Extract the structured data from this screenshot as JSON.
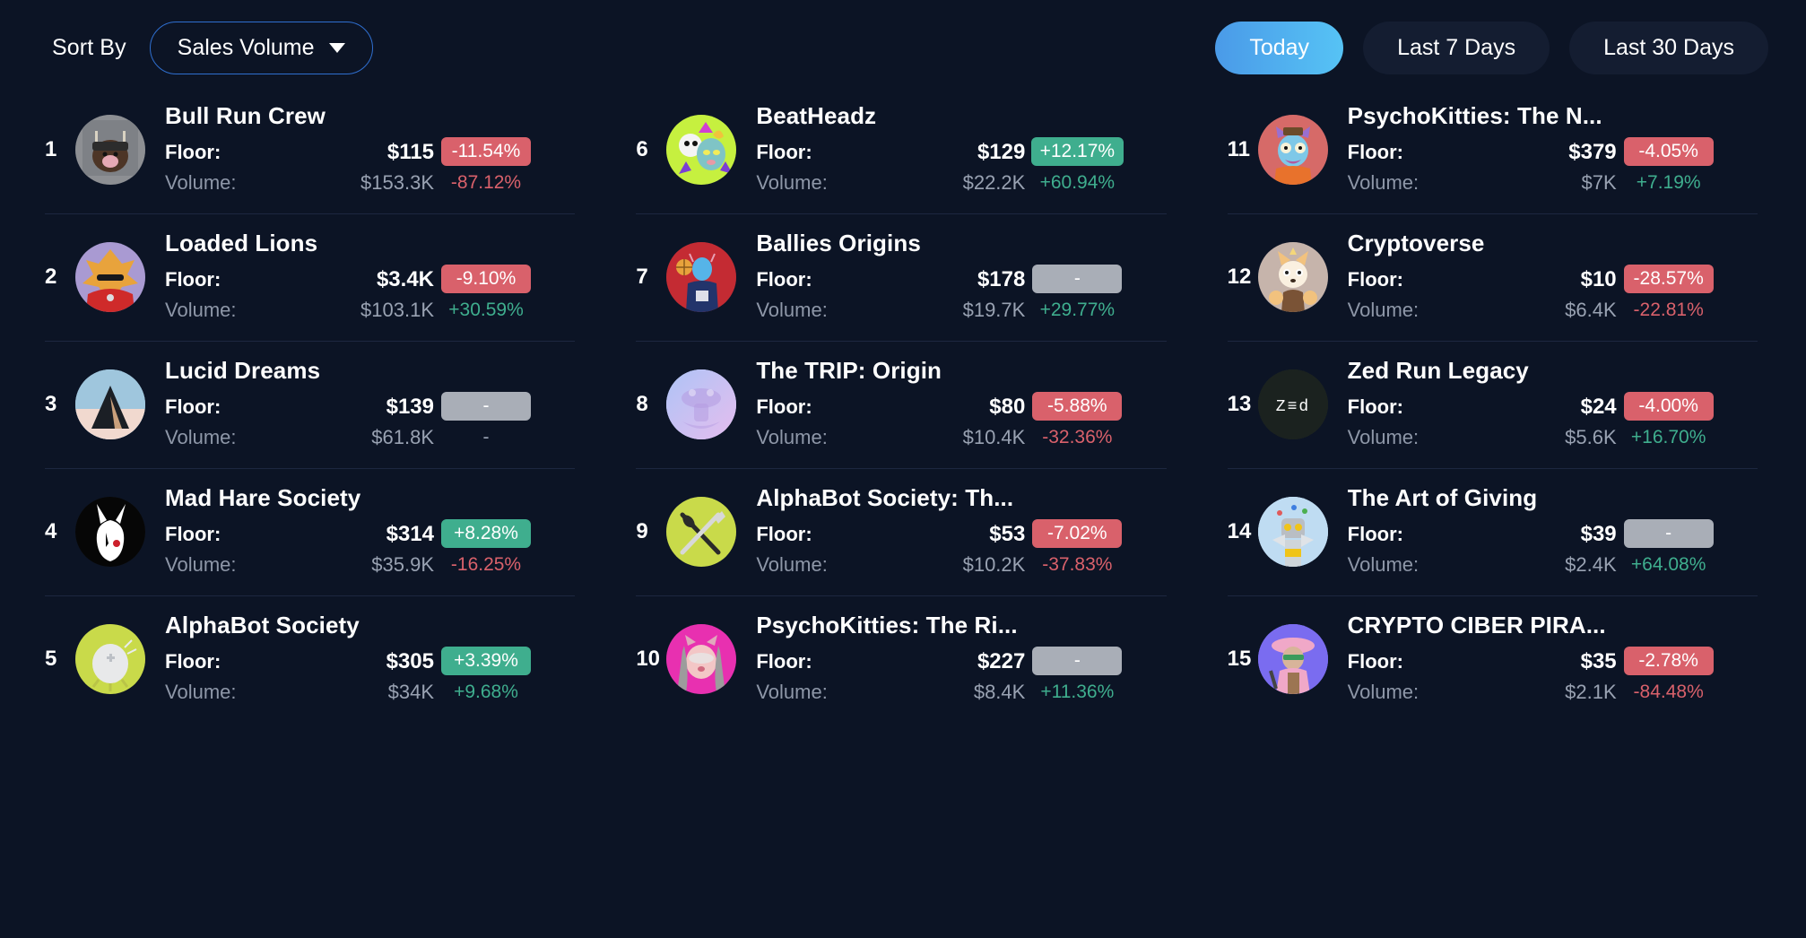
{
  "toolbar": {
    "sort_label": "Sort By",
    "sort_value": "Sales Volume",
    "ranges": [
      {
        "label": "Today",
        "active": true
      },
      {
        "label": "Last 7 Days",
        "active": false
      },
      {
        "label": "Last 30 Days",
        "active": false
      }
    ]
  },
  "labels": {
    "floor": "Floor:",
    "volume": "Volume:"
  },
  "colors": {
    "background": "#0c1425",
    "accent_gradient_from": "#4a9ae8",
    "accent_gradient_to": "#56c3f5",
    "badge_up": "#3fae8e",
    "badge_down": "#d9616b",
    "badge_flat": "#a9aeb7",
    "divider": "#1d2740",
    "muted_text": "#8e97a8"
  },
  "columns": [
    {
      "rows": [
        {
          "rank": "1",
          "name": "Bull Run Crew",
          "floor": "$115",
          "volume": "$153.3K",
          "floor_delta": "-11.54%",
          "floor_delta_dir": "down",
          "volume_delta": "-87.12%",
          "volume_delta_dir": "down",
          "avatar": {
            "bg": "#8d8f93",
            "fg": "#4d3526",
            "accent": "#2c2c2c",
            "kind": "bull"
          }
        },
        {
          "rank": "2",
          "name": "Loaded Lions",
          "floor": "$3.4K",
          "volume": "$103.1K",
          "floor_delta": "-9.10%",
          "floor_delta_dir": "down",
          "volume_delta": "+30.59%",
          "volume_delta_dir": "up",
          "avatar": {
            "bg": "#a99ad2",
            "fg": "#e8a33c",
            "accent": "#cf2a2a",
            "kind": "lion"
          }
        },
        {
          "rank": "3",
          "name": "Lucid Dreams",
          "floor": "$139",
          "volume": "$61.8K",
          "floor_delta": "-",
          "floor_delta_dir": "flat",
          "volume_delta": "-",
          "volume_delta_dir": "flat",
          "avatar": {
            "bg": "#9fc6dd",
            "fg": "#1b1f25",
            "accent": "#f1d9cf",
            "kind": "triangle"
          }
        },
        {
          "rank": "4",
          "name": "Mad Hare Society",
          "floor": "$314",
          "volume": "$35.9K",
          "floor_delta": "+8.28%",
          "floor_delta_dir": "up",
          "volume_delta": "-16.25%",
          "volume_delta_dir": "down",
          "avatar": {
            "bg": "#060606",
            "fg": "#ffffff",
            "accent": "#cc1f2b",
            "kind": "hare"
          }
        },
        {
          "rank": "5",
          "name": "AlphaBot Society",
          "floor": "$305",
          "volume": "$34K",
          "floor_delta": "+3.39%",
          "floor_delta_dir": "up",
          "volume_delta": "+9.68%",
          "volume_delta_dir": "up",
          "avatar": {
            "bg": "#c9da4a",
            "fg": "#e8e9ea",
            "accent": "#ffffff",
            "kind": "egg"
          }
        }
      ]
    },
    {
      "rows": [
        {
          "rank": "6",
          "name": "BeatHeadz",
          "floor": "$129",
          "volume": "$22.2K",
          "floor_delta": "+12.17%",
          "floor_delta_dir": "up",
          "volume_delta": "+60.94%",
          "volume_delta_dir": "up",
          "avatar": {
            "bg": "#c6f03f",
            "fg": "#7fc4c6",
            "accent": "#d13fd1",
            "kind": "beat"
          }
        },
        {
          "rank": "7",
          "name": "Ballies Origins",
          "floor": "$178",
          "volume": "$19.7K",
          "floor_delta": "-",
          "floor_delta_dir": "flat",
          "volume_delta": "+29.77%",
          "volume_delta_dir": "up",
          "avatar": {
            "bg": "#c42b33",
            "fg": "#56b4e8",
            "accent": "#22346b",
            "kind": "baller"
          }
        },
        {
          "rank": "8",
          "name": "The TRIP: Origin",
          "floor": "$80",
          "volume": "$10.4K",
          "floor_delta": "-5.88%",
          "floor_delta_dir": "down",
          "volume_delta": "-32.36%",
          "volume_delta_dir": "down",
          "avatar": {
            "bg": "#b4c6f5",
            "fg": "#b49ae0",
            "accent": "#e4b9ec",
            "kind": "mushroom"
          }
        },
        {
          "rank": "9",
          "name": "AlphaBot Society: Th...",
          "floor": "$53",
          "volume": "$10.2K",
          "floor_delta": "-7.02%",
          "floor_delta_dir": "down",
          "volume_delta": "-37.83%",
          "volume_delta_dir": "down",
          "avatar": {
            "bg": "#c9da4a",
            "fg": "#2a2a2a",
            "accent": "#d8d8d8",
            "kind": "swords"
          }
        },
        {
          "rank": "10",
          "name": "PsychoKitties: The Ri...",
          "floor": "$227",
          "volume": "$8.4K",
          "floor_delta": "-",
          "floor_delta_dir": "flat",
          "volume_delta": "+11.36%",
          "volume_delta_dir": "up",
          "avatar": {
            "bg": "#e830b0",
            "fg": "#f3c6c6",
            "accent": "#9c9c9c",
            "kind": "kitty-pink"
          }
        }
      ]
    },
    {
      "rows": [
        {
          "rank": "11",
          "name": "PsychoKitties: The N...",
          "floor": "$379",
          "volume": "$7K",
          "floor_delta": "-4.05%",
          "floor_delta_dir": "down",
          "volume_delta": "+7.19%",
          "volume_delta_dir": "up",
          "avatar": {
            "bg": "#d66a68",
            "fg": "#7ec8e8",
            "accent": "#e8722c",
            "kind": "kitty-red"
          }
        },
        {
          "rank": "12",
          "name": "Cryptoverse",
          "floor": "$10",
          "volume": "$6.4K",
          "floor_delta": "-28.57%",
          "floor_delta_dir": "down",
          "volume_delta": "-22.81%",
          "volume_delta_dir": "down",
          "avatar": {
            "bg": "#c6b4ab",
            "fg": "#f2c27e",
            "accent": "#7a5336",
            "kind": "shiba"
          }
        },
        {
          "rank": "13",
          "name": "Zed Run Legacy",
          "floor": "$24",
          "volume": "$5.6K",
          "floor_delta": "-4.00%",
          "floor_delta_dir": "down",
          "volume_delta": "+16.70%",
          "volume_delta_dir": "up",
          "avatar": {
            "bg": "#1b221f",
            "fg": "#ffffff",
            "accent": "#ffffff",
            "kind": "zed"
          }
        },
        {
          "rank": "14",
          "name": "The Art of Giving",
          "floor": "$39",
          "volume": "$2.4K",
          "floor_delta": "-",
          "floor_delta_dir": "flat",
          "volume_delta": "+64.08%",
          "volume_delta_dir": "up",
          "avatar": {
            "bg": "#bfdcf2",
            "fg": "#b9bec4",
            "accent": "#f0c419",
            "kind": "robot"
          }
        },
        {
          "rank": "15",
          "name": "CRYPTO CIBER PIRA...",
          "floor": "$35",
          "volume": "$2.1K",
          "floor_delta": "-2.78%",
          "floor_delta_dir": "down",
          "volume_delta": "-84.48%",
          "volume_delta_dir": "down",
          "avatar": {
            "bg": "#7a6cf0",
            "fg": "#f0a8c8",
            "accent": "#3b9b5c",
            "kind": "pirate"
          }
        }
      ]
    }
  ]
}
